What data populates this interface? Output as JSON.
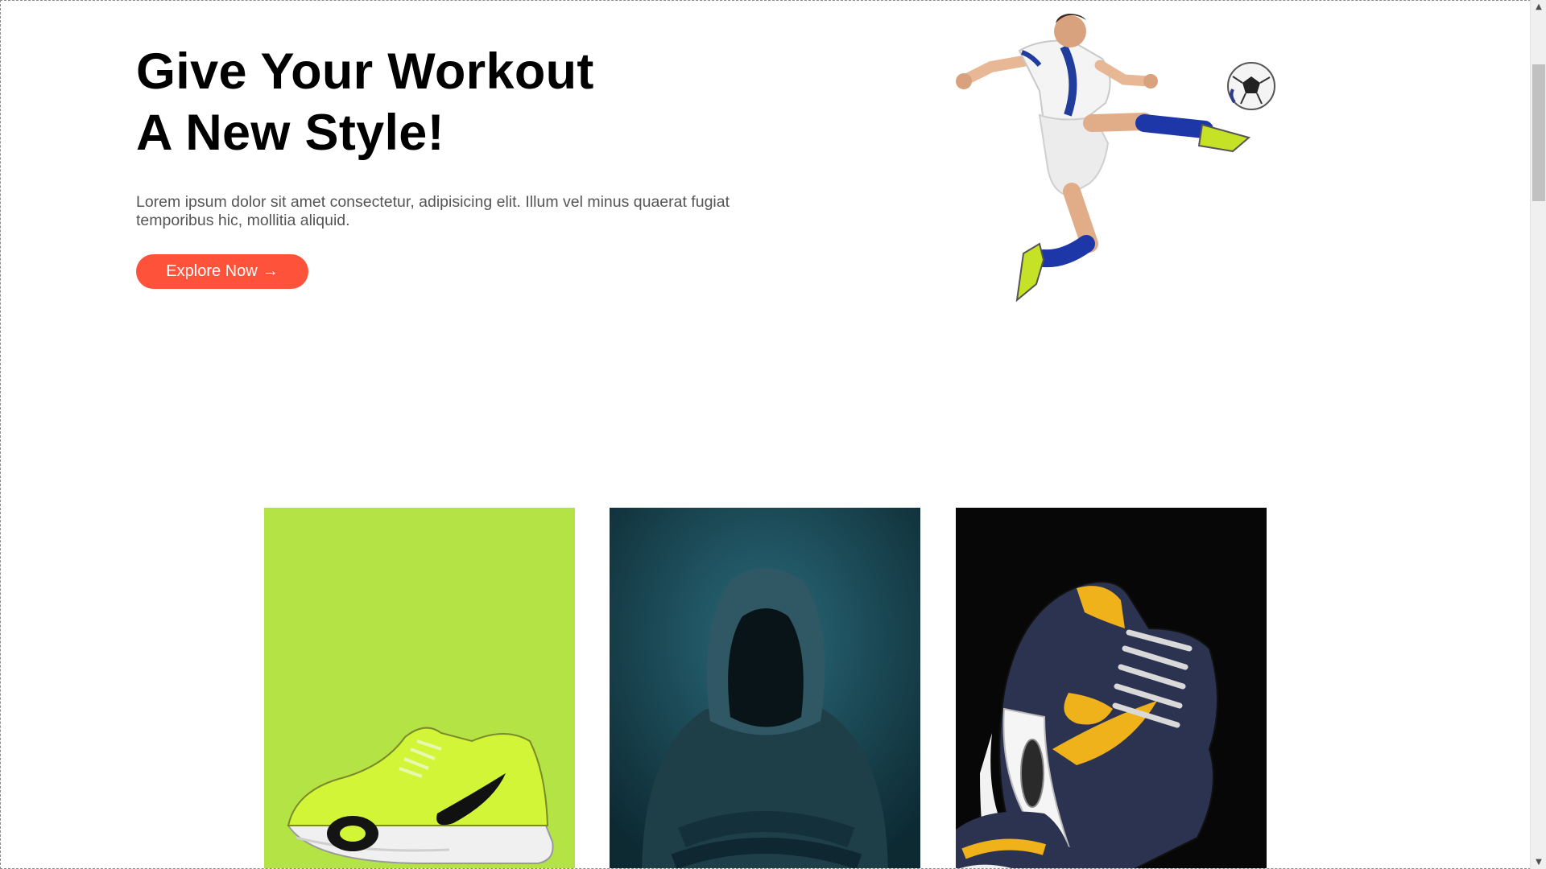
{
  "hero": {
    "title_line1": "Give Your Workout",
    "title_line2": "A New Style!",
    "description": "Lorem ipsum dolor sit amet consectetur, adipisicing elit. Illum vel minus quaerat fugiat temporibus hic, mollitia aliquid.",
    "button_label": "Explore Now",
    "button_arrow": "→",
    "image_icon": "soccer-player-kicking-ball"
  },
  "colors": {
    "accent": "#ff523b",
    "card_1_bg": "#b3e345",
    "card_2_bg": "#1f4f5e",
    "card_3_bg": "#070707"
  },
  "featured_cards": [
    {
      "image_icon": "green-sneaker"
    },
    {
      "image_icon": "hooded-figure"
    },
    {
      "image_icon": "navy-yellow-sneaker"
    }
  ],
  "scrollbar": {
    "up_icon": "▲",
    "down_icon": "▼"
  }
}
